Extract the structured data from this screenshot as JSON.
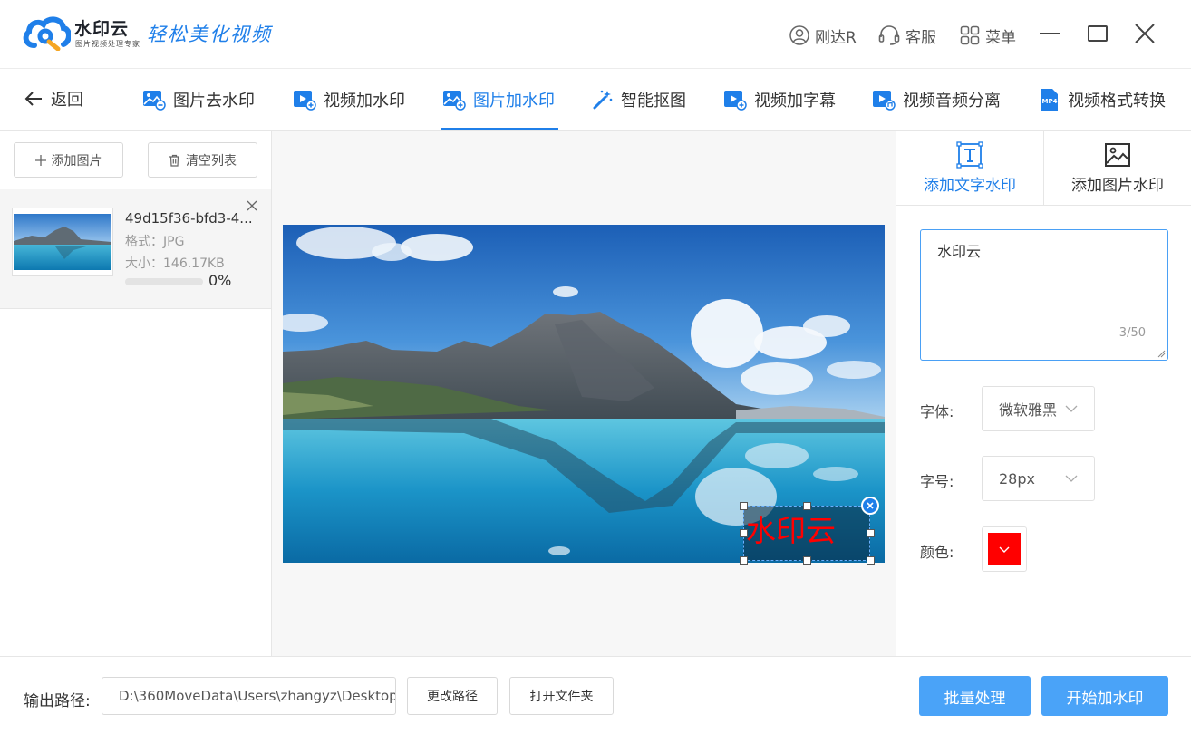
{
  "app": {
    "name": "水印云",
    "subtitle": "图片视频处理专家",
    "slogan": "轻松美化视频"
  },
  "titlebar": {
    "user": "刚达R",
    "service": "客服",
    "menu": "菜单"
  },
  "nav": {
    "back": "返回",
    "tabs": [
      {
        "label": "图片去水印",
        "icon": "image-remove-icon"
      },
      {
        "label": "视频加水印",
        "icon": "video-add-icon"
      },
      {
        "label": "图片加水印",
        "icon": "image-add-icon",
        "active": true
      },
      {
        "label": "智能抠图",
        "icon": "magic-wand-icon"
      },
      {
        "label": "视频加字幕",
        "icon": "video-subtitle-icon"
      },
      {
        "label": "视频音频分离",
        "icon": "video-audio-icon"
      },
      {
        "label": "视频格式转换",
        "icon": "mp4-icon",
        "badge": "MP4"
      }
    ]
  },
  "file_panel": {
    "add_button": "添加图片",
    "clear_button": "清空列表",
    "files": [
      {
        "name": "49d15f36-bfd3-4...",
        "format": "格式：JPG",
        "size": "大小：146.17KB",
        "progress": 0,
        "progress_label": "0%"
      }
    ]
  },
  "watermark_preview": {
    "text": "水印云",
    "color": "#ff0000"
  },
  "settings": {
    "tab_text": "添加文字水印",
    "tab_image": "添加图片水印",
    "text_value": "水印云",
    "char_count": "3/50",
    "font_label": "字体:",
    "font_value": "微软雅黑",
    "size_label": "字号:",
    "size_value": "28px",
    "color_label": "颜色:",
    "color_value": "#ff0000"
  },
  "bottom": {
    "output_label": "输出路径:",
    "output_path": "D:\\360MoveData\\Users\\zhangyz\\Desktop",
    "change_path": "更改路径",
    "open_folder": "打开文件夹",
    "batch": "批量处理",
    "start": "开始加水印"
  },
  "colors": {
    "accent": "#1f7fe9",
    "primary_button": "#4aa3f8"
  }
}
